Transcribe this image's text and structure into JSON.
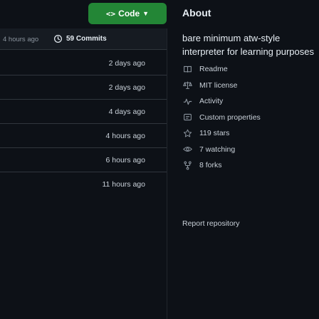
{
  "header": {
    "code_button_label": "Code",
    "code_button_glyph": "<>",
    "about_title": "About"
  },
  "commits": {
    "time_ago": "4 hours ago",
    "count_label": "59 Commits"
  },
  "file_rows": [
    {
      "time": "2 days ago"
    },
    {
      "time": "2 days ago"
    },
    {
      "time": "4 days ago"
    },
    {
      "time": "4 hours ago"
    },
    {
      "time": "6 hours ago"
    },
    {
      "time": "11 hours ago"
    }
  ],
  "about": {
    "description": "bare minimum atw-style interpreter for learning purposes",
    "items": [
      {
        "icon": "book-icon",
        "label": "Readme"
      },
      {
        "icon": "law-icon",
        "label": "MIT license"
      },
      {
        "icon": "pulse-icon",
        "label": "Activity"
      },
      {
        "icon": "note-icon",
        "label": "Custom properties"
      },
      {
        "icon": "star-icon",
        "label": "119 stars"
      },
      {
        "icon": "eye-icon",
        "label": "7 watching"
      },
      {
        "icon": "fork-icon",
        "label": "8 forks"
      }
    ],
    "report_label": "Report repository"
  },
  "colors": {
    "background": "#0d1117",
    "accent_green": "#238636",
    "muted_text": "#8b949e",
    "border": "#30363d"
  }
}
